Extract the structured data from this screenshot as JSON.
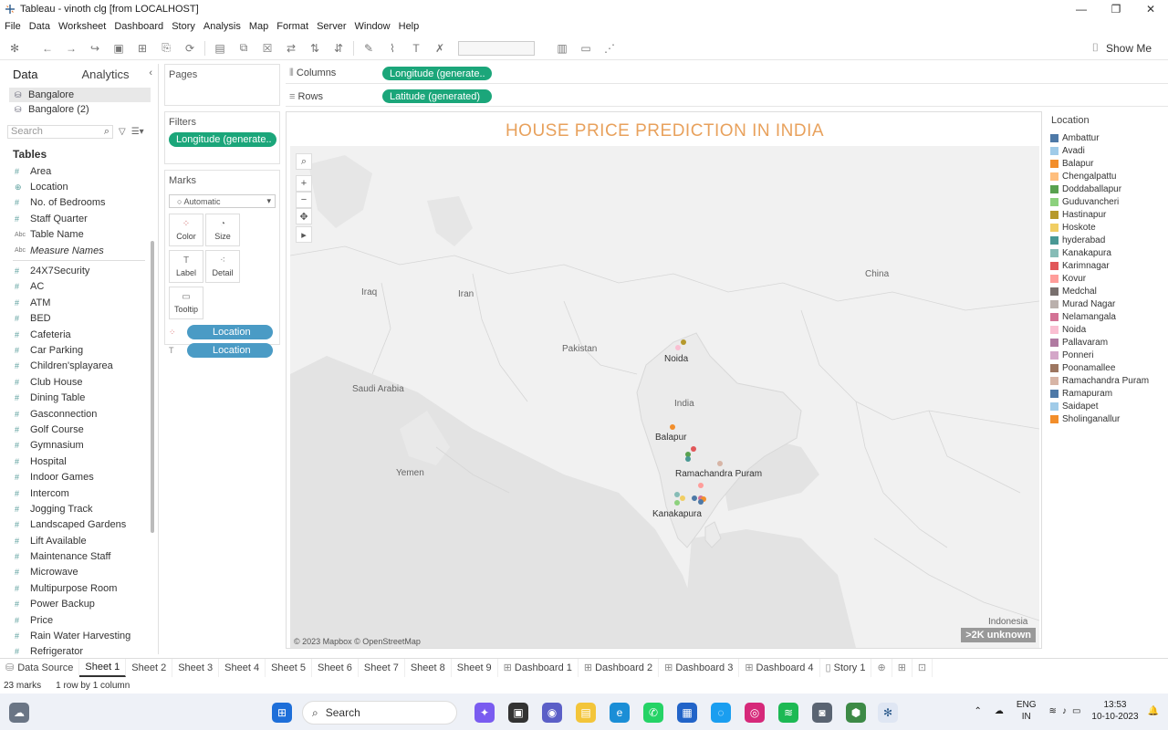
{
  "window": {
    "title": "Tableau - vinoth clg [from LOCALHOST]"
  },
  "menu": [
    "File",
    "Data",
    "Worksheet",
    "Dashboard",
    "Story",
    "Analysis",
    "Map",
    "Format",
    "Server",
    "Window",
    "Help"
  ],
  "toolbar": {
    "show_me": "Show Me"
  },
  "left_pane": {
    "tab_data": "Data",
    "tab_analytics": "Analytics",
    "datasources": [
      "Bangalore",
      "Bangalore (2)"
    ],
    "search_placeholder": "Search",
    "tables_header": "Tables",
    "fields": [
      {
        "type": "#",
        "name": "Area"
      },
      {
        "type": "⊕",
        "name": "Location"
      },
      {
        "type": "#",
        "name": "No. of Bedrooms"
      },
      {
        "type": "#",
        "name": "Staff Quarter"
      },
      {
        "type": "Abc",
        "name": "Table Name"
      },
      {
        "type": "Abc",
        "name": "Measure Names"
      }
    ],
    "measures": [
      "24X7Security",
      "AC",
      "ATM",
      "BED",
      "Cafeteria",
      "Car Parking",
      "Children'splayarea",
      "Club House",
      "Dining Table",
      "Gasconnection",
      "Golf Course",
      "Gymnasium",
      "Hospital",
      "Indoor Games",
      "Intercom",
      "Jogging Track",
      "Landscaped Gardens",
      "Lift Available",
      "Maintenance Staff",
      "Microwave",
      "Multipurpose Room",
      "Power Backup",
      "Price",
      "Rain Water Harvesting",
      "Refrigerator"
    ]
  },
  "cards": {
    "pages": "Pages",
    "filters": "Filters",
    "filter_pill": "Longitude (generate..",
    "marks": "Marks",
    "mark_type": "Automatic",
    "mark_buttons": [
      "Color",
      "Size",
      "Label",
      "Detail",
      "Tooltip"
    ],
    "mark_pills": [
      "Location",
      "Location"
    ]
  },
  "shelves": {
    "columns_label": "Columns",
    "columns_pill": "Longitude (generate..",
    "rows_label": "Rows",
    "rows_pill": "Latitude (generated)"
  },
  "view": {
    "title": "HOUSE PRICE PREDICTION IN INDIA",
    "map_labels": [
      "Iraq",
      "Iran",
      "Pakistan",
      "Saudi Arabia",
      "Yemen",
      "India",
      "China",
      "Indonesia"
    ],
    "city_labels": [
      "Noida",
      "Balapur",
      "Ramachandra Puram",
      "Kanakapura"
    ],
    "copyright": "© 2023 Mapbox © OpenStreetMap",
    "unknown_badge": ">2K unknown"
  },
  "legend": {
    "title": "Location",
    "items": [
      {
        "name": "Ambattur",
        "color": "#4e79a7"
      },
      {
        "name": "Avadi",
        "color": "#a0cbe8"
      },
      {
        "name": "Balapur",
        "color": "#f28e2b"
      },
      {
        "name": "Chengalpattu",
        "color": "#ffbe7d"
      },
      {
        "name": "Doddaballapur",
        "color": "#59a14f"
      },
      {
        "name": "Guduvancheri",
        "color": "#8cd17d"
      },
      {
        "name": "Hastinapur",
        "color": "#b6992d"
      },
      {
        "name": "Hoskote",
        "color": "#f1ce63"
      },
      {
        "name": "hyderabad",
        "color": "#499894"
      },
      {
        "name": "Kanakapura",
        "color": "#86bcb6"
      },
      {
        "name": "Karimnagar",
        "color": "#e15759"
      },
      {
        "name": "Kovur",
        "color": "#ff9d9a"
      },
      {
        "name": "Medchal",
        "color": "#79706e"
      },
      {
        "name": "Murad Nagar",
        "color": "#bab0ac"
      },
      {
        "name": "Nelamangala",
        "color": "#d37295"
      },
      {
        "name": "Noida",
        "color": "#fabfd2"
      },
      {
        "name": "Pallavaram",
        "color": "#b07aa1"
      },
      {
        "name": "Ponneri",
        "color": "#d4a6c8"
      },
      {
        "name": "Poonamallee",
        "color": "#9d7660"
      },
      {
        "name": "Ramachandra Puram",
        "color": "#d7b5a6"
      },
      {
        "name": "Ramapuram",
        "color": "#4e79a7"
      },
      {
        "name": "Saidapet",
        "color": "#a0cbe8"
      },
      {
        "name": "Sholinganallur",
        "color": "#f28e2b"
      }
    ]
  },
  "sheet_tabs": [
    "Data Source",
    "Sheet 1",
    "Sheet 2",
    "Sheet 3",
    "Sheet 4",
    "Sheet 5",
    "Sheet 6",
    "Sheet 7",
    "Sheet 8",
    "Sheet 9",
    "Dashboard 1",
    "Dashboard 2",
    "Dashboard 3",
    "Dashboard 4",
    "Story 1"
  ],
  "status": {
    "marks": "23 marks",
    "rows_cols": "1 row by 1 column"
  },
  "taskbar": {
    "search": "Search",
    "lang": "ENG",
    "region": "IN",
    "time": "13:53",
    "date": "10-10-2023"
  }
}
